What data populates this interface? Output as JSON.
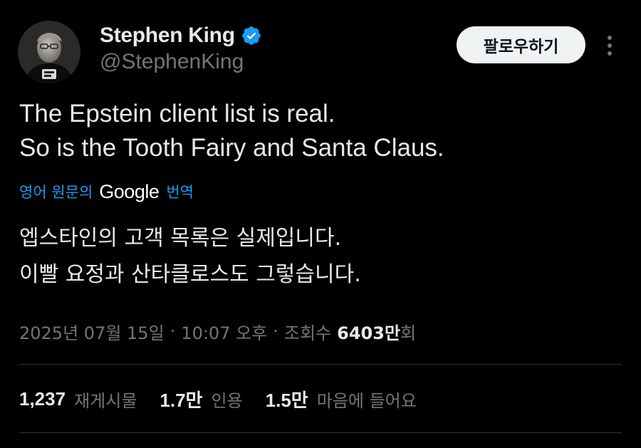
{
  "author": {
    "name": "Stephen King",
    "handle": "@StephenKing",
    "verified_icon": "verified-badge-icon",
    "verified_color": "#1d9bf0"
  },
  "actions": {
    "follow_label": "팔로우하기",
    "more_icon": "more-vertical-icon"
  },
  "tweet": {
    "lines": [
      "The Epstein client list is real.",
      "So is the Tooth Fairy and Santa Claus."
    ]
  },
  "translation": {
    "prefix": "영어 원문의",
    "provider": "Google",
    "suffix": "번역",
    "lines": [
      "엡스타인의 고객 목록은 실제입니다.",
      "이빨 요정과 산타클로스도 그렇습니다."
    ]
  },
  "meta": {
    "date": "2025년 07월 15일",
    "separator": "·",
    "time": "10:07 오후",
    "views_label": "조회수",
    "views_count": "6403만",
    "views_suffix": "회"
  },
  "stats": {
    "reposts_value": "1,237",
    "reposts_label": "재게시물",
    "quotes_value": "1.7만",
    "quotes_label": "인용",
    "likes_value": "1.5만",
    "likes_label": "마음에 들어요"
  },
  "colors": {
    "background": "#000000",
    "text_primary": "#e7e9ea",
    "text_secondary": "#71767b",
    "link": "#1d9bf0",
    "divider": "#2f3336"
  }
}
